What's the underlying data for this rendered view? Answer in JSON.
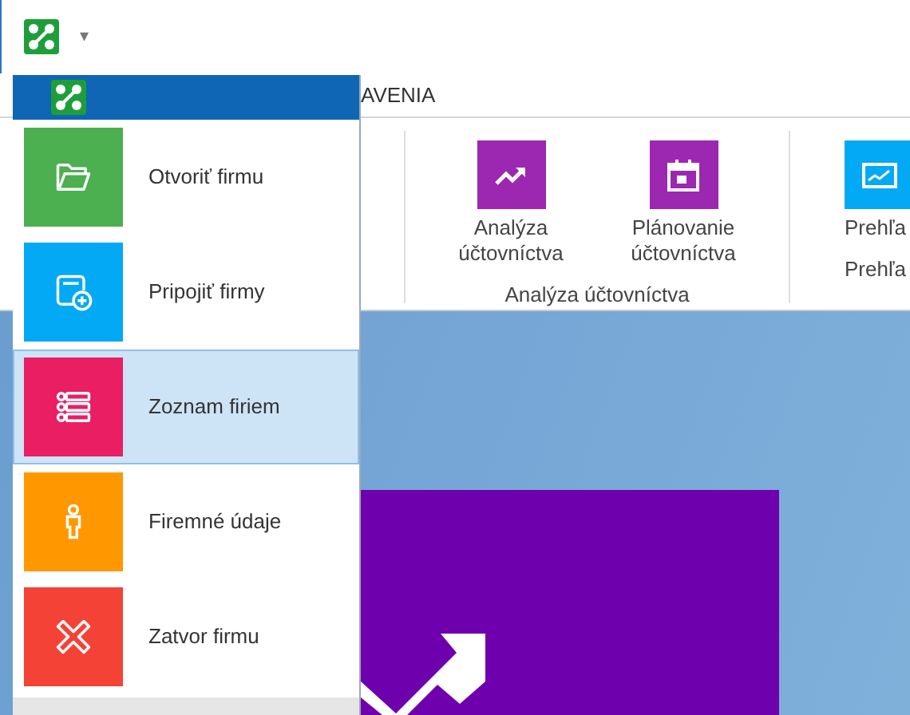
{
  "quick_access": {
    "dropdown_glyph": "▾"
  },
  "ribbon": {
    "tab_label": "AVENIA",
    "groups": [
      {
        "buttons": [
          {
            "label": "Analýza účtovníctva",
            "kind": "trend",
            "color": "#9c27b0"
          },
          {
            "label": "Plánovanie účtovníctva",
            "kind": "calendar",
            "color": "#9c27b0"
          }
        ],
        "label": "Analýza účtovníctva"
      },
      {
        "buttons": [
          {
            "label": "Prehľa",
            "kind": "chart",
            "color": "#03a9f4"
          }
        ],
        "label": "Prehľa"
      }
    ]
  },
  "app_menu": {
    "items": [
      {
        "label": "Otvoriť firmu",
        "kind": "folder",
        "color": "#4caf50",
        "selected": false
      },
      {
        "label": "Pripojiť firmy",
        "kind": "add",
        "color": "#03a9f4",
        "selected": false
      },
      {
        "label": "Zoznam firiem",
        "kind": "list",
        "color": "#e91e63",
        "selected": true
      },
      {
        "label": "Firemné údaje",
        "kind": "person",
        "color": "#ff9800",
        "selected": false
      },
      {
        "label": "Zatvor firmu",
        "kind": "close",
        "color": "#f44336",
        "selected": false
      }
    ]
  }
}
